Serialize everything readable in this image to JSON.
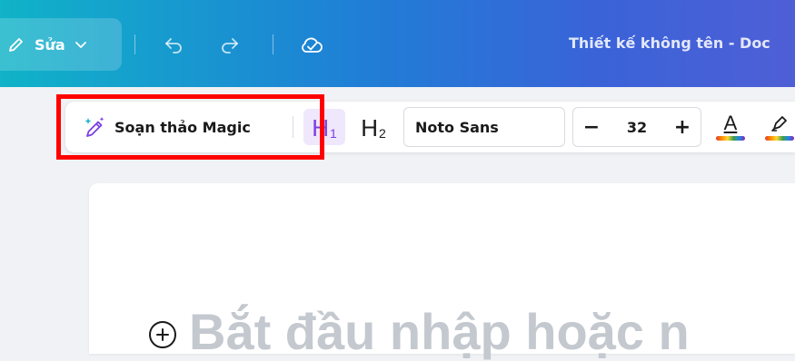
{
  "topbar": {
    "edit_label": "Sửa",
    "doc_title": "Thiết kế không tên - Doc"
  },
  "toolbar": {
    "magic_write_label": "Soạn thảo Magic",
    "h1": {
      "big": "H",
      "small": "1"
    },
    "h2": {
      "big": "H",
      "small": "2"
    },
    "font_name": "Noto Sans",
    "font_size": "32",
    "decrease_label": "−",
    "increase_label": "+",
    "text_color_letter": "A"
  },
  "editor": {
    "placeholder": "Bắt đầu nhập hoặc n"
  },
  "colors": {
    "highlight_box": "#ff0000",
    "h1_active_bg": "#efe7fb",
    "h1_active_fg": "#7b3fe4"
  }
}
